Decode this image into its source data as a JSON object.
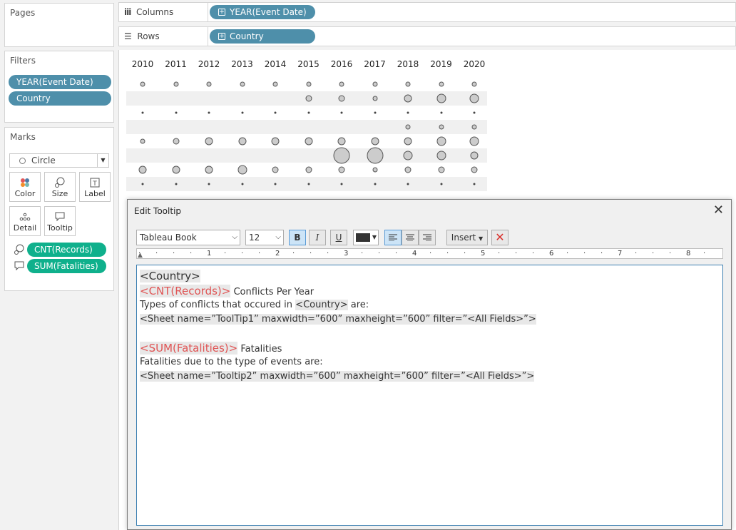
{
  "pages": {
    "title": "Pages"
  },
  "filters": {
    "title": "Filters",
    "items": [
      "YEAR(Event Date)",
      "Country"
    ]
  },
  "marks": {
    "title": "Marks",
    "mark_type": "Circle",
    "buttons": [
      "Color",
      "Size",
      "Label",
      "Detail",
      "Tooltip"
    ],
    "fields": [
      "CNT(Records)",
      "SUM(Fatalities)"
    ]
  },
  "shelves": {
    "columns_label": "Columns",
    "columns_pill": "YEAR(Event Date)",
    "rows_label": "Rows",
    "rows_pill": "Country"
  },
  "chart_data": {
    "type": "scatter",
    "years": [
      "2010",
      "2011",
      "2012",
      "2013",
      "2014",
      "2015",
      "2016",
      "2017",
      "2018",
      "2019",
      "2020"
    ],
    "rows": [
      [
        2,
        2,
        2,
        2,
        2,
        2,
        2,
        2,
        2,
        2,
        2
      ],
      [
        0,
        0,
        0,
        0,
        0,
        3,
        3,
        2,
        4,
        5,
        5
      ],
      [
        1,
        1,
        1,
        1,
        1,
        1,
        1,
        1,
        1,
        1,
        1
      ],
      [
        0,
        0,
        0,
        0,
        0,
        0,
        0,
        0,
        2,
        2,
        2
      ],
      [
        2,
        3,
        4,
        4,
        4,
        4,
        4,
        4,
        4,
        5,
        5
      ],
      [
        0,
        0,
        0,
        0,
        0,
        0,
        7,
        7,
        5,
        5,
        4
      ],
      [
        4,
        4,
        4,
        5,
        3,
        3,
        3,
        2,
        3,
        3,
        3
      ],
      [
        1,
        1,
        1,
        1,
        1,
        1,
        1,
        1,
        1,
        1,
        1
      ]
    ]
  },
  "tooltip": {
    "title": "Edit Tooltip",
    "font": "Tableau Book",
    "size": "12",
    "bold": "B",
    "italic": "I",
    "underline": "U",
    "insert": "Insert",
    "ruler": [
      "1",
      "2",
      "3",
      "4",
      "5",
      "6",
      "7",
      "8"
    ],
    "line1": "<Country>",
    "line2a": "<CNT(Records)>",
    "line2b": " Conflicts Per Year",
    "line3a": "Types of conflicts that occured in ",
    "line3b": "<Country>",
    "line3c": " are:",
    "line4": "<Sheet name=”ToolTip1” maxwidth=”600” maxheight=”600” filter=”<All Fields>”>",
    "line6a": "<SUM(Fatalities)>",
    "line6b": " Fatalities",
    "line7": "Fatalities due to the type of events are:",
    "line8": "<Sheet name=”Tooltip2” maxwidth=”600” maxheight=”600” filter=”<All Fields>”>"
  }
}
